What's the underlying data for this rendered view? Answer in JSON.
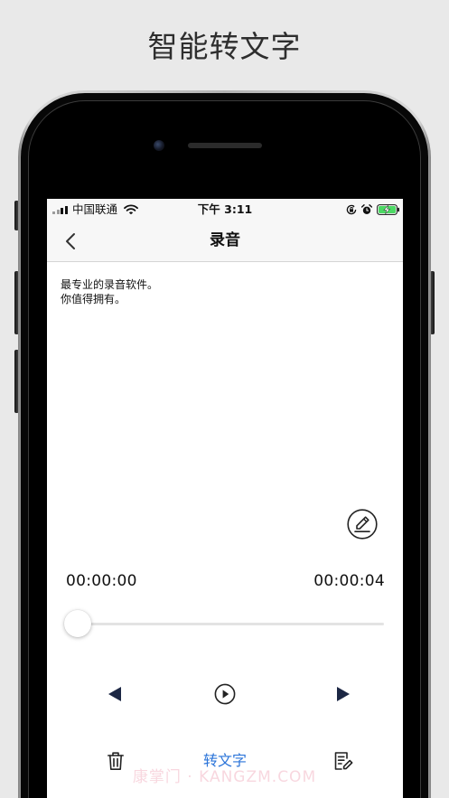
{
  "promo": {
    "headline": "智能转文字"
  },
  "status_bar": {
    "carrier": "中国联通",
    "time": "下午 3:11",
    "battery_charging": true
  },
  "nav": {
    "title": "录音"
  },
  "note": {
    "lines": [
      "最专业的录音软件。",
      "你值得拥有。"
    ]
  },
  "player": {
    "elapsed": "00:00:00",
    "duration": "00:00:04",
    "progress": 0
  },
  "toolbar": {
    "convert_label": "转文字"
  },
  "watermark": "康掌门 · KANGZM.COM",
  "icons": {
    "back": "chevron-left-icon",
    "edit": "pencil-icon",
    "previous": "triangle-left-icon",
    "play": "play-circle-icon",
    "next": "triangle-right-icon",
    "delete": "trash-icon",
    "export": "note-edit-icon",
    "signal": "signal-strength-icon",
    "wifi": "wifi-icon",
    "orientation_lock": "orientation-lock-icon",
    "alarm": "alarm-icon",
    "battery": "battery-icon"
  },
  "colors": {
    "accent": "#2b74d9",
    "controls": "#1c2744",
    "battery": "#4cd964",
    "bar_background": "#f7f7f7"
  }
}
